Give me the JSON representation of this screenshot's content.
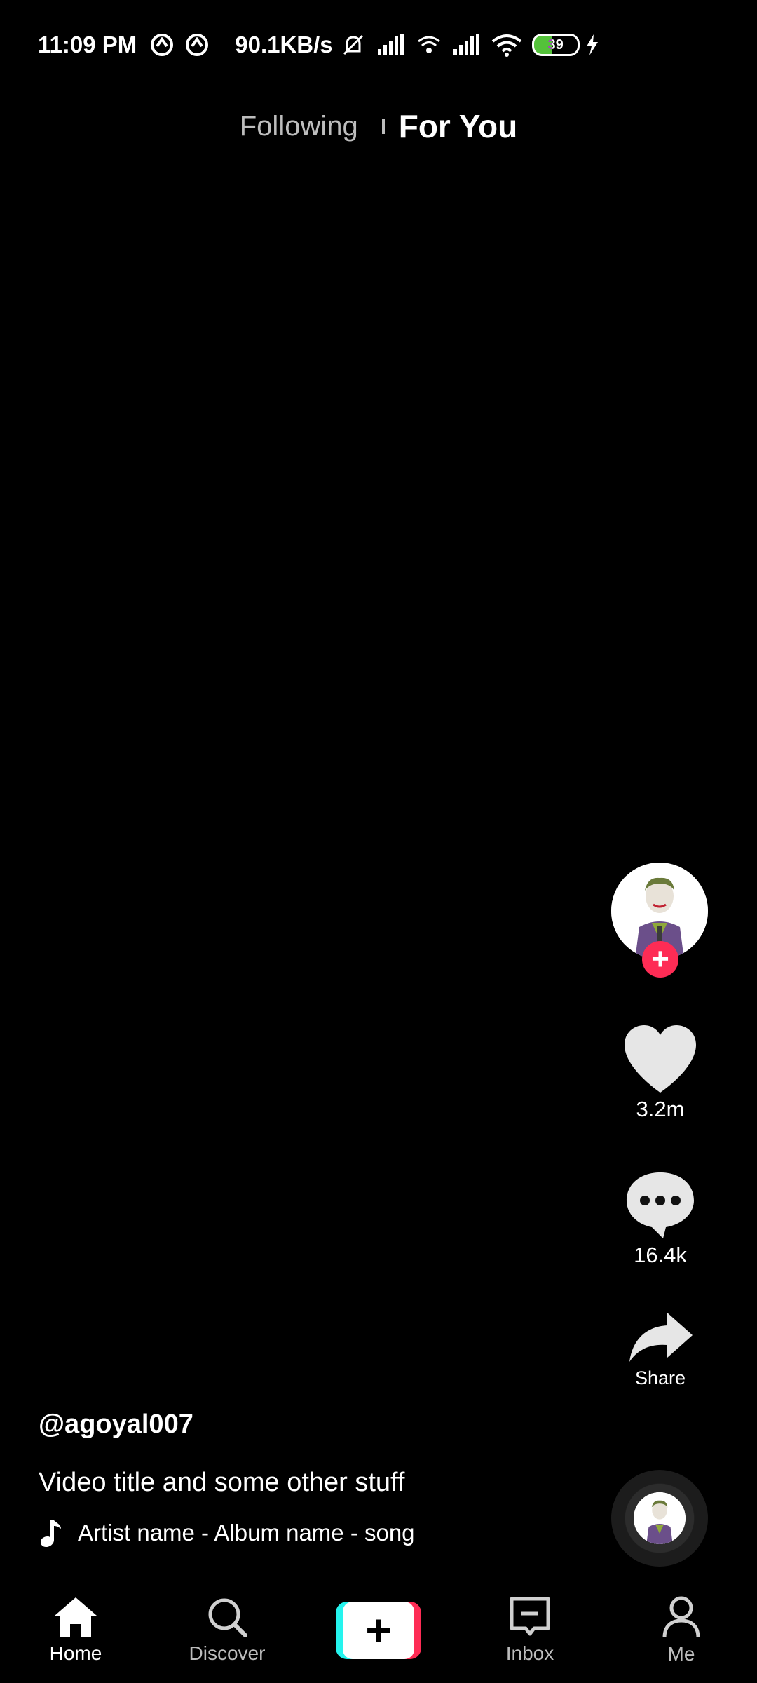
{
  "status_bar": {
    "time": "11:09 PM",
    "network_speed": "90.1KB/s",
    "battery": "39"
  },
  "top_tabs": {
    "following": "Following",
    "for_you": "For You"
  },
  "actions": {
    "likes": "3.2m",
    "comments": "16.4k",
    "share": "Share"
  },
  "caption": {
    "username": "@agoyal007",
    "title": "Video title and some other stuff",
    "music": "Artist name - Album name - song"
  },
  "bottom_nav": {
    "home": "Home",
    "discover": "Discover",
    "inbox": "Inbox",
    "me": "Me"
  },
  "colors": {
    "background": "#000000",
    "accent_red": "#fe2c55",
    "accent_cyan": "#25f4ee",
    "battery_fill": "#54c23a"
  }
}
